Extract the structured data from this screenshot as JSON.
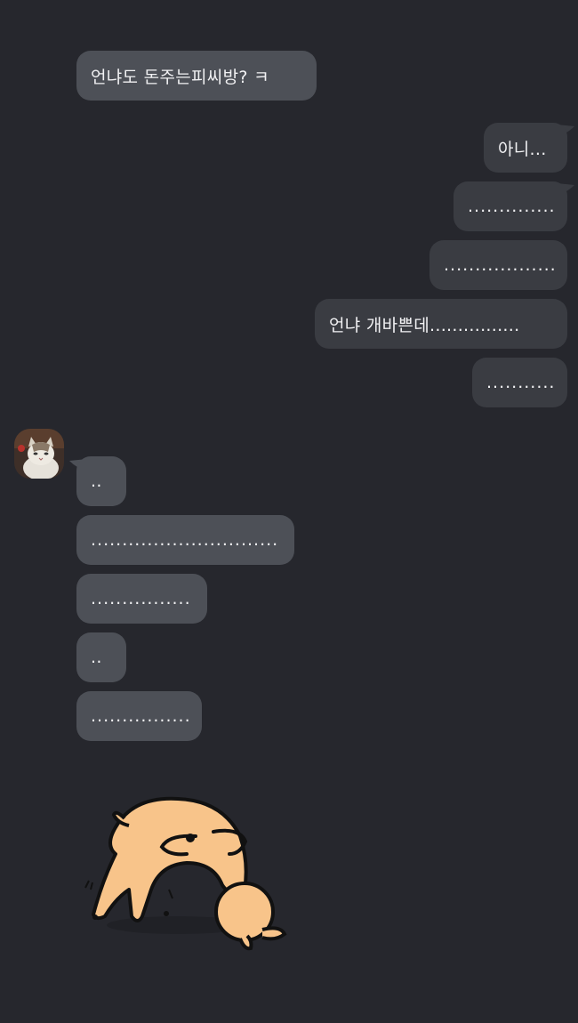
{
  "messages": {
    "m1": "언냐도 돈주는피씨방? ㅋ",
    "m2": "아니...",
    "m3": "..............",
    "m4": "..................",
    "m5": "언냐 개바쁜데................",
    "m6": "...........",
    "m7": "..",
    "m8": "..............................",
    "m9": "................",
    "m10": "..",
    "m11": "................"
  },
  "colors": {
    "background": "#26272d",
    "incoming_bubble": "#4d5057",
    "outgoing_bubble": "#3a3c42",
    "text": "#f1f1f3"
  },
  "icons": {
    "avatar": "cat-photo-avatar",
    "sticker": "bowing-dog-sticker"
  }
}
